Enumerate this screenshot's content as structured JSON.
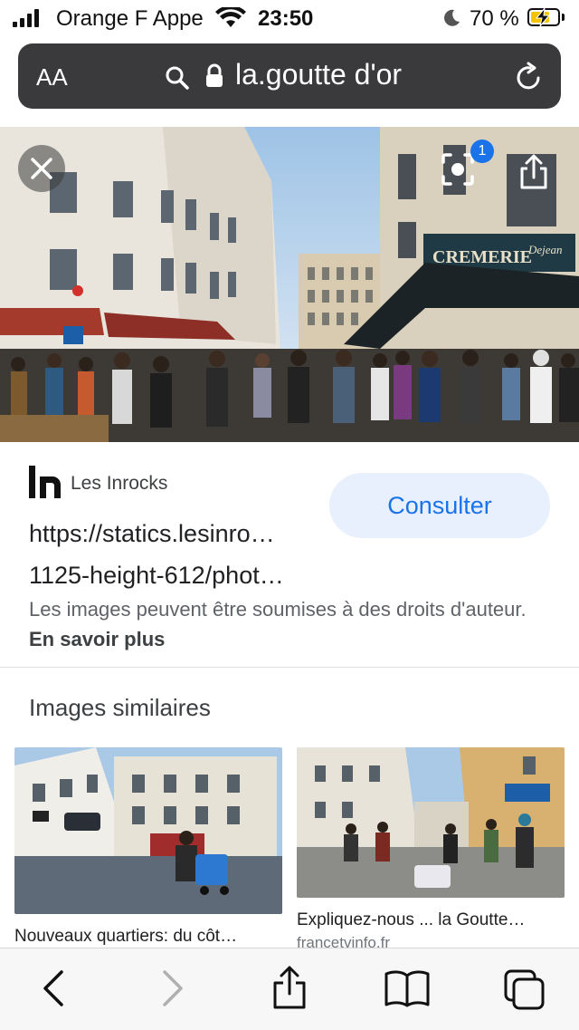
{
  "status_bar": {
    "carrier": "Orange F Appe",
    "time": "23:50",
    "battery_percent": "70 %",
    "battery_level": 0.7,
    "icons": [
      "signal-icon",
      "wifi-icon",
      "moon-icon",
      "battery-icon"
    ]
  },
  "url_bar": {
    "text_size_label": "AA",
    "address": "la.goutte d'or",
    "icons": [
      "search-icon",
      "lock-icon",
      "reload-icon"
    ]
  },
  "hero": {
    "shop_sign": "CREMERIE",
    "shop_sign_sub": "Dejean",
    "lens_badge_count": "1",
    "icons": [
      "close-icon",
      "lens-icon",
      "share-icon"
    ]
  },
  "source": {
    "name": "Les Inrocks",
    "url_line1": "https://statics.lesinro…",
    "url_line2": "1125-height-612/phot…",
    "consult_label": "Consulter"
  },
  "rights": {
    "text": "Les images peuvent être soumises à des droits d'auteur.",
    "link": "En savoir plus"
  },
  "similar": {
    "title": "Images similaires",
    "items": [
      {
        "caption": "Nouveaux quartiers: du côt…",
        "source": ""
      },
      {
        "caption": "Expliquez-nous ... la Goutte…",
        "source": "francetvinfo.fr"
      }
    ]
  },
  "toolbar": {
    "icons": [
      "back-icon",
      "forward-icon",
      "share-icon",
      "bookmarks-icon",
      "tabs-icon"
    ]
  }
}
